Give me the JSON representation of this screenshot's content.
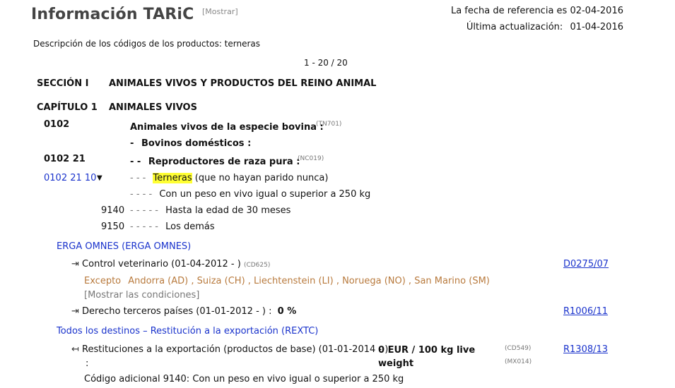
{
  "header": {
    "title": "Información TARiC",
    "show_label": "[Mostrar]",
    "ref_date_label": "La fecha de referencia es 02-04-2016",
    "updated_label": "Última actualización:",
    "updated_date": "01-04-2016"
  },
  "description": "Descripción de los códigos de los productos: terneras",
  "pagination": "1 - 20 / 20",
  "section": {
    "label": "SECCIÓN I",
    "title": "ANIMALES VIVOS Y PRODUCTOS DEL REINO ANIMAL"
  },
  "chapter": {
    "label": "CAPÍTULO 1",
    "title": "ANIMALES VIVOS"
  },
  "codes": {
    "c0102": {
      "code": "0102",
      "desc": "Animales vivos de la especie bovina :",
      "note": "(TN701)"
    },
    "bovinos": {
      "dashes": "-",
      "desc": "Bovinos domésticos :"
    },
    "c010221": {
      "code": "0102 21",
      "dashes": "- -",
      "desc": "Reproductores de raza pura :",
      "note": "(NC019)"
    },
    "c01022110": {
      "code": "0102 21 10",
      "toggle": "▼",
      "dashes": "- - -",
      "highlight": "Terneras",
      "rest": "(que no hayan parido nunca)"
    },
    "peso": {
      "dashes": "- - - -",
      "desc": "Con un peso en vivo igual o superior a 250 kg"
    },
    "s9140": {
      "code": "9140",
      "dashes": "- - - - -",
      "desc": "Hasta la edad de 30 meses"
    },
    "s9150": {
      "code": "9150",
      "dashes": "- - - - -",
      "desc": "Los demás"
    }
  },
  "erga": {
    "heading": "ERGA OMNES (ERGA OMNES)",
    "m1": {
      "icon": "⇥",
      "text": "Control veterinario (01-04-2012 - )",
      "note": "(CD625)",
      "reg": "D0275/07",
      "except_label": "Excepto",
      "except_countries": "Andorra (AD) , Suiza (CH) , Liechtenstein (LI) , Noruega (NO) , San Marino (SM)",
      "show_conditions": "[Mostrar las condiciones]"
    },
    "m2": {
      "icon": "⇥",
      "text": "Derecho terceros países (01-01-2012 - ) :",
      "value": "0 %",
      "reg": "R1006/11"
    }
  },
  "todos": {
    "heading": "Todos los destinos – Restitución a la exportación (REXTC)",
    "m1": {
      "icon": "↤",
      "text": "Restituciones a la exportación (productos de base) (01-01-2014 - )",
      "colon": ":",
      "value1": "0 EUR / 100 kg live",
      "value2": "weight",
      "note1": "(CD549)",
      "note2": "(MX014)",
      "reg": "R1308/13"
    },
    "additional": "Código adicional 9140: Con un peso en vivo igual o superior a 250 kg"
  }
}
